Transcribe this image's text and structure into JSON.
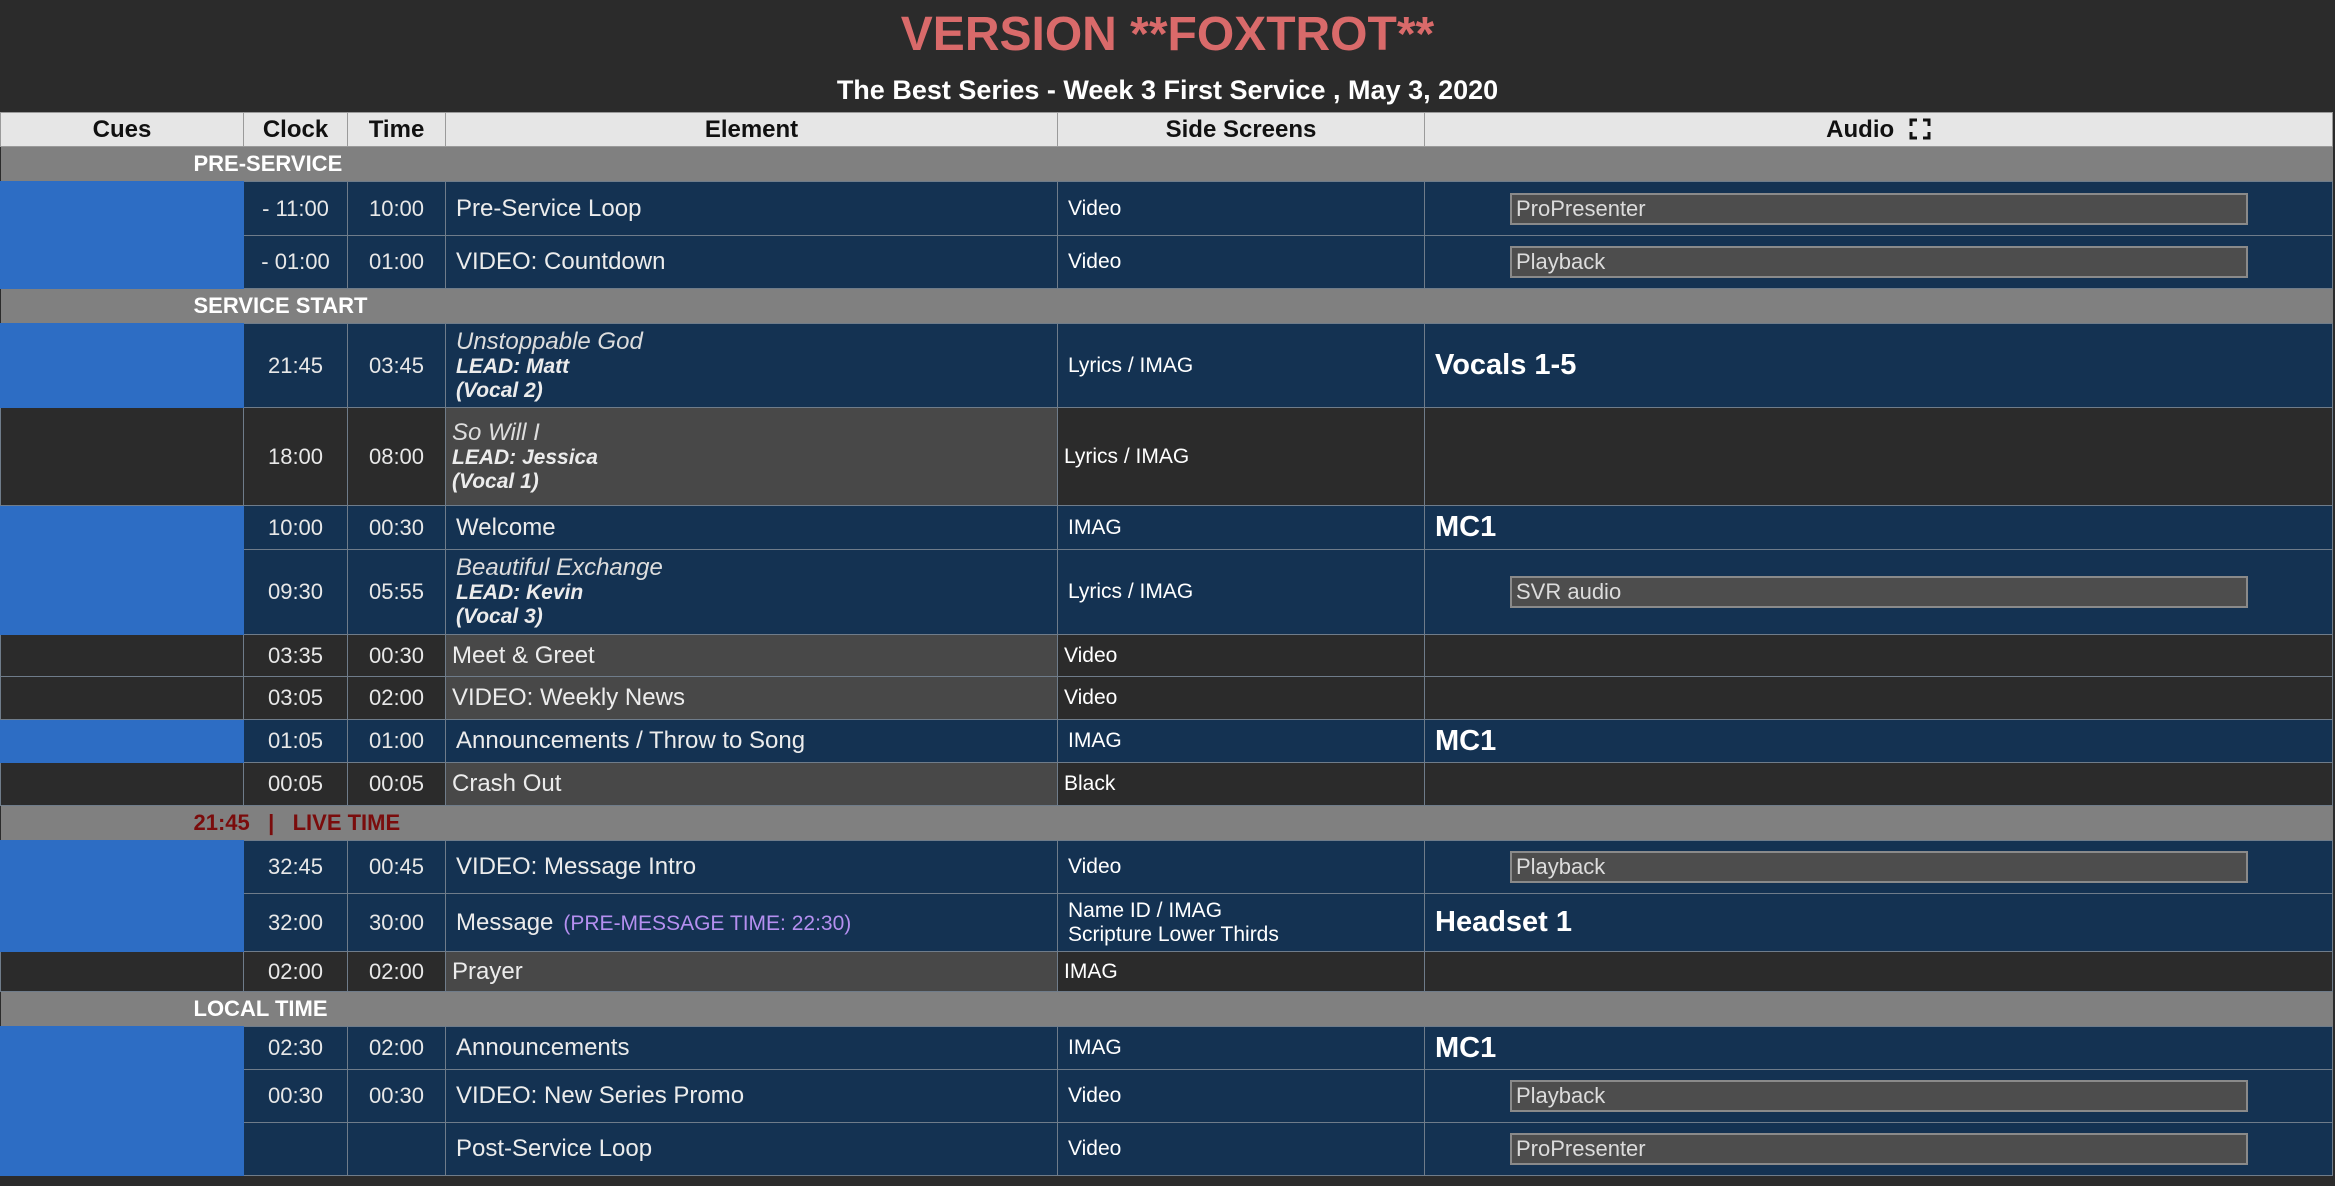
{
  "header": {
    "title": "VERSION **FOXTROT**",
    "subtitle": "The Best Series - Week 3 First Service , May 3, 2020"
  },
  "columns": {
    "cues": "Cues",
    "clock": "Clock",
    "time": "Time",
    "element": "Element",
    "side_screens": "Side Screens",
    "audio": "Audio",
    "audio_icon": "fullscreen-icon"
  },
  "sections": {
    "pre_service": "PRE-SERVICE",
    "service_start": "SERVICE START",
    "live_time": "21:45   |   LIVE TIME",
    "local_time": "LOCAL TIME"
  },
  "rows": [
    {
      "clock": "- 11:00",
      "time": "10:00",
      "element": "Pre-Service Loop",
      "screens": "Video",
      "audio_box": "ProPresenter"
    },
    {
      "clock": "- 01:00",
      "time": "01:00",
      "element": "VIDEO: Countdown",
      "screens": "Video",
      "audio_box": "Playback"
    },
    {
      "clock": "21:45",
      "time": "03:45",
      "song": "Unstoppable God",
      "lead": "LEAD: Matt",
      "vocal": "(Vocal 2)",
      "screens": "Lyrics / IMAG",
      "audio_big": "Vocals 1-5"
    },
    {
      "clock": "18:00",
      "time": "08:00",
      "song": "So Will I",
      "lead": "LEAD: Jessica",
      "vocal": "(Vocal 1)",
      "screens": "Lyrics / IMAG"
    },
    {
      "clock": "10:00",
      "time": "00:30",
      "element": "Welcome",
      "screens": "IMAG",
      "audio_big": "MC1"
    },
    {
      "clock": "09:30",
      "time": "05:55",
      "song": "Beautiful Exchange",
      "lead": "LEAD: Kevin",
      "vocal": "(Vocal 3)",
      "screens": "Lyrics / IMAG",
      "audio_box": "SVR audio"
    },
    {
      "clock": "03:35",
      "time": "00:30",
      "element": "Meet & Greet",
      "screens": "Video"
    },
    {
      "clock": "03:05",
      "time": "02:00",
      "element": "VIDEO: Weekly News",
      "screens": "Video"
    },
    {
      "clock": "01:05",
      "time": "01:00",
      "element": "Announcements / Throw to Song",
      "screens": "IMAG",
      "audio_big": "MC1"
    },
    {
      "clock": "00:05",
      "time": "00:05",
      "element": "Crash Out",
      "screens": "Black"
    },
    {
      "clock": "32:45",
      "time": "00:45",
      "element": "VIDEO: Message Intro",
      "screens": "Video",
      "audio_box": "Playback"
    },
    {
      "clock": "32:00",
      "time": "30:00",
      "element": "Message",
      "note": "(PRE-MESSAGE TIME:  22:30)",
      "screens": "Name ID / IMAG",
      "screens2": "Scripture Lower Thirds",
      "audio_big": "Headset 1"
    },
    {
      "clock": "02:00",
      "time": "02:00",
      "element": "Prayer",
      "screens": "IMAG"
    },
    {
      "clock": "02:30",
      "time": "02:00",
      "element": "Announcements",
      "screens": "IMAG",
      "audio_big": "MC1"
    },
    {
      "clock": "00:30",
      "time": "00:30",
      "element": "VIDEO: New Series Promo",
      "screens": "Video",
      "audio_box": "Playback"
    },
    {
      "clock": "",
      "time": "",
      "element": "Post-Service Loop",
      "screens": "Video",
      "audio_box": "ProPresenter"
    }
  ],
  "colors": {
    "title": "#d96a6a",
    "cue_blue": "#2d6dc4",
    "row_blue": "#143252",
    "row_dark": "#2b2b2b",
    "section": "#808080",
    "live_time": "#7a0c0c",
    "pre_message": "#b58ff0"
  }
}
